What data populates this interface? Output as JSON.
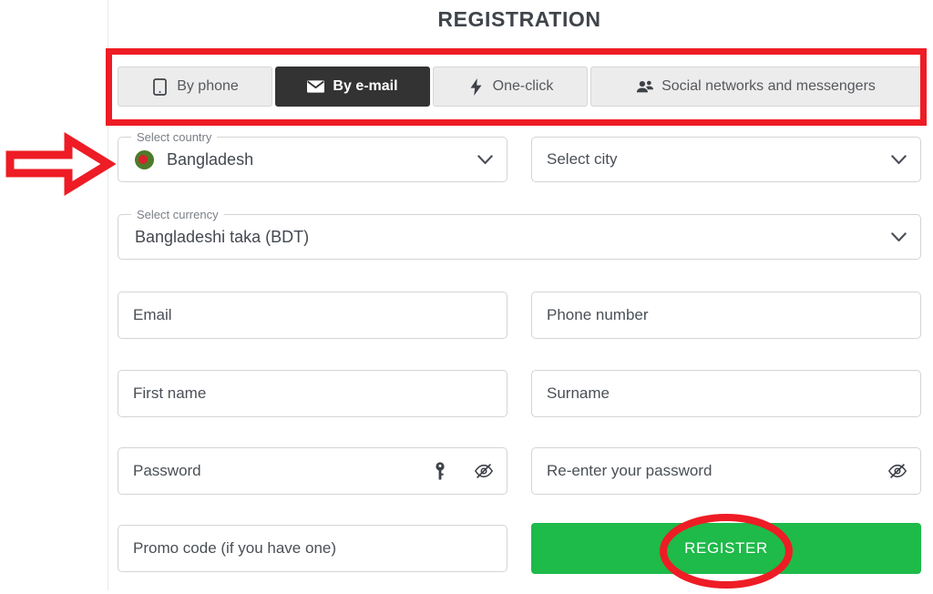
{
  "page": {
    "title": "REGISTRATION"
  },
  "tabs": [
    {
      "label": "By phone",
      "icon": "mobile-phone-icon",
      "active": false
    },
    {
      "label": "By e-mail",
      "icon": "envelope-icon",
      "active": true
    },
    {
      "label": "One-click",
      "icon": "lightning-bolt-icon",
      "active": false
    },
    {
      "label": "Social networks and messengers",
      "icon": "users-icon",
      "active": false
    }
  ],
  "form": {
    "country": {
      "legend": "Select country",
      "value": "Bangladesh",
      "flag": "bangladesh-flag-icon"
    },
    "city": {
      "placeholder": "Select city"
    },
    "currency": {
      "legend": "Select currency",
      "value": "Bangladeshi taka (BDT)"
    },
    "email": {
      "placeholder": "Email",
      "value": ""
    },
    "phone": {
      "placeholder": "Phone number",
      "value": ""
    },
    "first_name": {
      "placeholder": "First name",
      "value": ""
    },
    "surname": {
      "placeholder": "Surname",
      "value": ""
    },
    "password": {
      "placeholder": "Password",
      "value": "",
      "icons": [
        "key-icon",
        "eye-slash-icon"
      ]
    },
    "password_repeat": {
      "placeholder": "Re-enter your password",
      "value": "",
      "icons": [
        "eye-slash-icon"
      ]
    },
    "promo": {
      "placeholder": "Promo code (if you have one)",
      "value": ""
    },
    "submit": {
      "label": "REGISTER"
    }
  },
  "colors": {
    "accent_green": "#1eba4a",
    "annotation_red": "#ee1c25",
    "active_tab_bg": "#333333",
    "tab_bg": "#ececec",
    "flag_green": "#4f7a2a",
    "flag_red": "#d8232a"
  },
  "annotations": [
    {
      "name": "highlight-rectangle-tabs",
      "shape": "rectangle",
      "color": "#ee1c25"
    },
    {
      "name": "pointer-arrow-country",
      "shape": "arrow-right",
      "color": "#ee1c25"
    },
    {
      "name": "highlight-ellipse-register",
      "shape": "ellipse",
      "color": "#ee1c25"
    }
  ]
}
